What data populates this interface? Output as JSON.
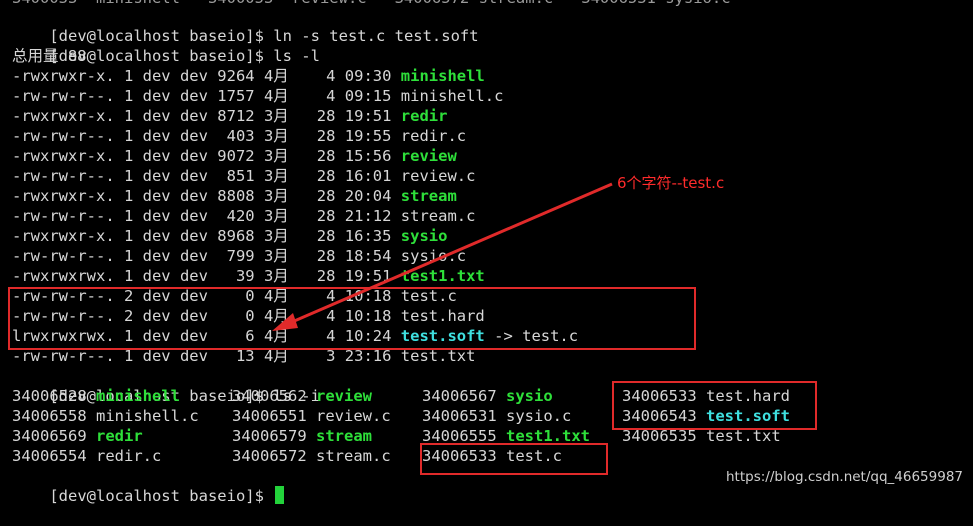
{
  "terminal": {
    "top_partial": "3400033  minishell   3400053  review.c   34006572 stream.c   34006531 sysio.c",
    "prompt": "[dev@localhost baseio]$ ",
    "commands": {
      "ln": "ln -s test.c test.soft",
      "ls_l": "ls -l",
      "ls_i": "ls -i"
    },
    "total_line": "总用量 88",
    "listing": [
      {
        "meta": "-rwxrwxr-x. 1 dev dev 9264 4月    4 09:30 ",
        "name": "minishell",
        "kind": "exe"
      },
      {
        "meta": "-rw-rw-r--. 1 dev dev 1757 4月    4 09:15 ",
        "name": "minishell.c",
        "kind": "file"
      },
      {
        "meta": "-rwxrwxr-x. 1 dev dev 8712 3月   28 19:51 ",
        "name": "redir",
        "kind": "exe"
      },
      {
        "meta": "-rw-rw-r--. 1 dev dev  403 3月   28 19:55 ",
        "name": "redir.c",
        "kind": "file"
      },
      {
        "meta": "-rwxrwxr-x. 1 dev dev 9072 3月   28 15:56 ",
        "name": "review",
        "kind": "exe"
      },
      {
        "meta": "-rw-rw-r--. 1 dev dev  851 3月   28 16:01 ",
        "name": "review.c",
        "kind": "file"
      },
      {
        "meta": "-rwxrwxr-x. 1 dev dev 8808 3月   28 20:04 ",
        "name": "stream",
        "kind": "exe"
      },
      {
        "meta": "-rw-rw-r--. 1 dev dev  420 3月   28 21:12 ",
        "name": "stream.c",
        "kind": "file"
      },
      {
        "meta": "-rwxrwxr-x. 1 dev dev 8968 3月   28 16:35 ",
        "name": "sysio",
        "kind": "exe"
      },
      {
        "meta": "-rw-rw-r--. 1 dev dev  799 3月   28 18:54 ",
        "name": "sysio.c",
        "kind": "file"
      },
      {
        "meta": "-rwxrwxrwx. 1 dev dev   39 3月   28 19:51 ",
        "name": "test1.txt",
        "kind": "exe"
      },
      {
        "meta": "-rw-rw-r--. 2 dev dev    0 4月    4 10:18 ",
        "name": "test.c",
        "kind": "file"
      },
      {
        "meta": "-rw-rw-r--. 2 dev dev    0 4月    4 10:18 ",
        "name": "test.hard",
        "kind": "file"
      },
      {
        "meta": "lrwxrwxrwx. 1 dev dev    6 4月    4 10:24 ",
        "name": "test.soft",
        "kind": "link",
        "target": " -> test.c"
      },
      {
        "meta": "-rw-rw-r--. 1 dev dev   13 4月    3 23:16 ",
        "name": "test.txt",
        "kind": "file"
      }
    ],
    "inode_rows": [
      [
        {
          "inode": "34006528",
          "name": "minishell",
          "kind": "exe"
        },
        {
          "inode": "34006562",
          "name": "review",
          "kind": "exe"
        },
        {
          "inode": "34006567",
          "name": "sysio",
          "kind": "exe"
        },
        {
          "inode": "34006533",
          "name": "test.hard",
          "kind": "file"
        }
      ],
      [
        {
          "inode": "34006558",
          "name": "minishell.c",
          "kind": "file"
        },
        {
          "inode": "34006551",
          "name": "review.c",
          "kind": "file"
        },
        {
          "inode": "34006531",
          "name": "sysio.c",
          "kind": "file"
        },
        {
          "inode": "34006543",
          "name": "test.soft",
          "kind": "link"
        }
      ],
      [
        {
          "inode": "34006569",
          "name": "redir",
          "kind": "exe"
        },
        {
          "inode": "34006579",
          "name": "stream",
          "kind": "exe"
        },
        {
          "inode": "34006555",
          "name": "test1.txt",
          "kind": "exe"
        },
        {
          "inode": "34006535",
          "name": "test.txt",
          "kind": "file"
        }
      ],
      [
        {
          "inode": "34006554",
          "name": "redir.c",
          "kind": "file"
        },
        {
          "inode": "34006572",
          "name": "stream.c",
          "kind": "file"
        },
        {
          "inode": "34006533",
          "name": "test.c",
          "kind": "file"
        }
      ]
    ]
  },
  "annotation": {
    "text": "6个字符--test.c",
    "color": "#e02a2a"
  },
  "watermark": "https://blog.csdn.net/qq_46659987",
  "colors": {
    "background": "#000000",
    "text": "#d7d7d7",
    "executable": "#2ee03a",
    "symlink": "#3fe0e0",
    "cursor": "#23d33b"
  }
}
